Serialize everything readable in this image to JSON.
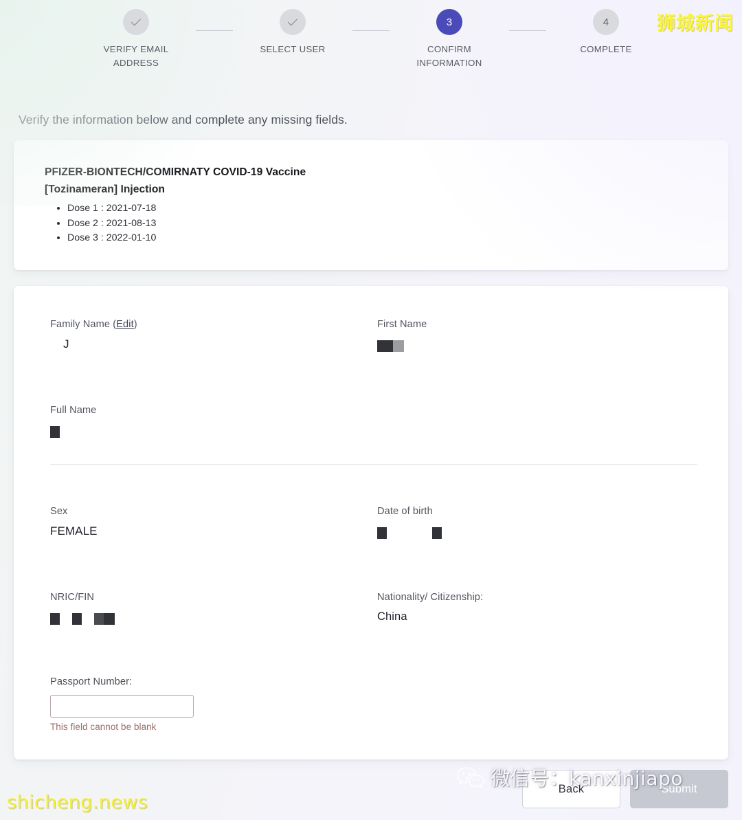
{
  "stepper": {
    "steps": [
      {
        "marker": "check",
        "label": "VERIFY EMAIL ADDRESS",
        "state": "done"
      },
      {
        "marker": "check",
        "label": "SELECT USER",
        "state": "done"
      },
      {
        "marker": "3",
        "label": "CONFIRM INFORMATION",
        "state": "active"
      },
      {
        "marker": "4",
        "label": "COMPLETE",
        "state": "todo"
      }
    ],
    "active_color": "#4a4ab8",
    "inactive_color": "#d9dade"
  },
  "intro": {
    "text": "Verify the information below and complete any missing fields."
  },
  "vaccine": {
    "title_line1": "PFIZER-BIONTECH/COMIRNATY COVID-19 Vaccine",
    "title_line2": "[Tozinameran] Injection",
    "doses": [
      "Dose 1 : 2021-07-18",
      "Dose 2 : 2021-08-13",
      "Dose 3 : 2022-01-10"
    ]
  },
  "details": {
    "family_name": {
      "label_prefix": "Family Name (",
      "edit_link": "Edit",
      "label_suffix": ")",
      "value": "J"
    },
    "first_name": {
      "label": "First Name",
      "value": "[redacted]"
    },
    "full_name": {
      "label": "Full Name",
      "value": "[redacted]"
    },
    "sex": {
      "label": "Sex",
      "value": "FEMALE"
    },
    "date_of_birth": {
      "label": "Date of birth",
      "value": "[redacted]"
    },
    "nric_fin": {
      "label": "NRIC/FIN",
      "value": "[redacted]"
    },
    "nationality": {
      "label": "Nationality/ Citizenship:",
      "value": "China"
    },
    "passport": {
      "label": "Passport Number:",
      "value": "",
      "placeholder": "",
      "error": "This field cannot be blank"
    }
  },
  "footer": {
    "back_label": "Back",
    "submit_label": "Submit"
  },
  "watermarks": {
    "top_right": "狮城新闻",
    "bottom_left": "shicheng.news",
    "wechat": "微信号：kanxinjiapo"
  }
}
